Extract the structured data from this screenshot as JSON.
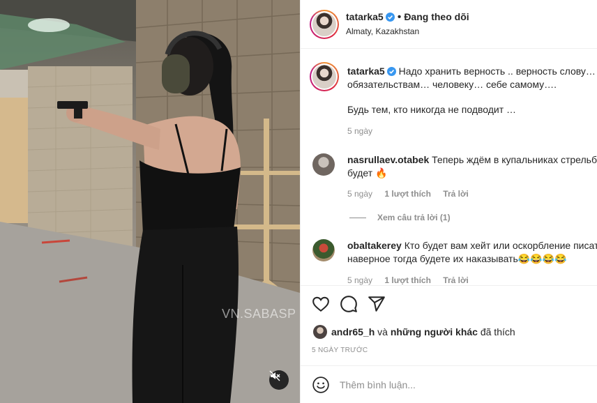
{
  "post": {
    "author": "tatarka5",
    "follow_status": "Đang theo dõi",
    "location": "Almaty, Kazakhstan",
    "watermark": "VN.SABASP",
    "caption_line1": "Надо хранить верность .. верность слову…",
    "caption_line2": "обязательствам… человеку… себе самому….",
    "caption_line3": "Будь тем, кто никогда не подводит …",
    "caption_age": "5 ngày"
  },
  "comments": [
    {
      "user": "nasrullaev.otabek",
      "text_line1": "Теперь ждём в купальниках стрельба",
      "text_line2": "будет 🔥",
      "age": "5 ngày",
      "likes": "1 lượt thích",
      "reply": "Trả lời",
      "view_replies": "Xem câu trả lời (1)"
    },
    {
      "user": "obaltakerey",
      "text_line1": "Кто будет вам хейт или оскорбление писать",
      "text_line2": "наверное тогда будете их наказывать😂😂😂😂",
      "age": "5 ngày",
      "likes": "1 lượt thích",
      "reply": "Trả lời"
    }
  ],
  "likes": {
    "user": "andr65_h",
    "conj": "và",
    "others": "những người khác",
    "suffix": "đã thích"
  },
  "date": "5 NGÀY TRƯỚC",
  "comment_box": {
    "placeholder": "Thêm bình luận..."
  },
  "icons": [
    "verified-badge-icon",
    "heart-icon",
    "comment-icon",
    "share-icon",
    "emoji-icon",
    "mute-icon"
  ],
  "colors": {
    "verified": "#3897f0",
    "muted_text": "#8e8e8e",
    "fire": "#f56040"
  }
}
